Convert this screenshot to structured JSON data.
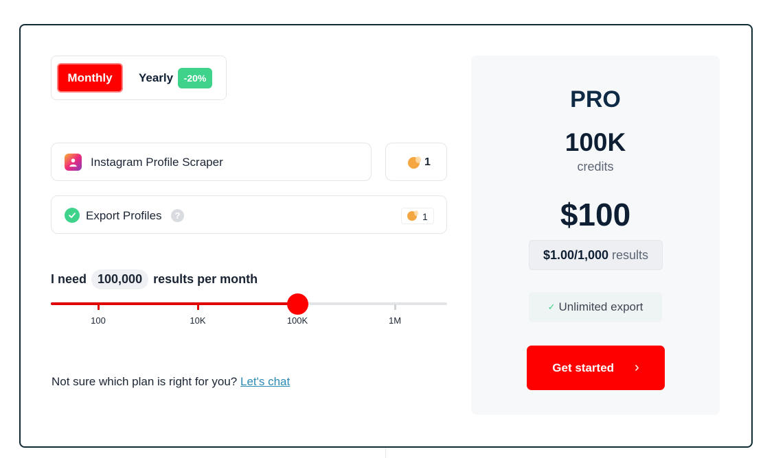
{
  "billing_toggle": {
    "monthly_label": "Monthly",
    "yearly_label": "Yearly",
    "yearly_discount": "-20%",
    "selected": "Monthly"
  },
  "product": {
    "name": "Instagram Profile Scraper",
    "icon": "instagram-profile-icon",
    "credit_cost": "1"
  },
  "export": {
    "label": "Export Profiles",
    "help_symbol": "?",
    "credit_cost": "1"
  },
  "volume": {
    "prefix": "I need",
    "value": "100,000",
    "suffix": "results per month",
    "slider": {
      "ticks": [
        "100",
        "10K",
        "100K",
        "1M"
      ],
      "selected_index": 2
    }
  },
  "help": {
    "text": "Not sure which plan is right for you?",
    "link": "Let's chat"
  },
  "plan": {
    "name": "PRO",
    "credits": "100K",
    "credits_label": "credits",
    "price": "$100",
    "rate": "$1.00/1,000",
    "rate_unit": "results",
    "feature": "Unlimited export",
    "cta": "Get started",
    "cta_icon": "chevron-right-icon"
  },
  "colors": {
    "accent": "#ff0000",
    "discount_badge": "#3ed28a",
    "text_dark": "#0f1f33",
    "link": "#2a8ab3"
  }
}
